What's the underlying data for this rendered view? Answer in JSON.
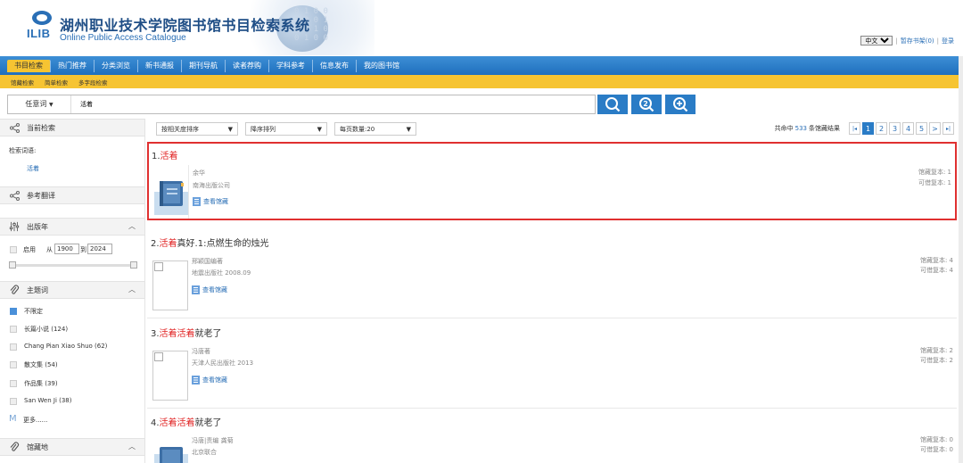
{
  "header": {
    "logo_text": "ILIB",
    "title": "湖州职业技术学院图书馆书目检索系统",
    "subtitle": "Online Public Access Catalogue",
    "binary_deco": "0 1 0 0\n1 0 0 1\n0 0 1 0\n0 1 0 0",
    "lang_value": "中文",
    "bookshelf_link": "暂存书架(0)",
    "login_link": "登录"
  },
  "nav": {
    "items": [
      "书目检索",
      "热门推荐",
      "分类浏览",
      "新书通报",
      "期刊导航",
      "读者荐购",
      "学科参考",
      "信息发布",
      "我的图书馆"
    ]
  },
  "subnav": {
    "items": [
      "馆藏检索",
      "简单检索",
      "多字段检索"
    ]
  },
  "search": {
    "field_label": "任意词",
    "query": "活着"
  },
  "sidebar": {
    "current": {
      "title": "当前检索",
      "label": "检索词语:",
      "value": "活着"
    },
    "translate": {
      "title": "参考翻译"
    },
    "year": {
      "title": "出版年",
      "enable": "启用",
      "from_label": "从",
      "from": "1900",
      "to_label": "到",
      "to": "2024"
    },
    "subject": {
      "title": "主题词",
      "items": [
        "不限定",
        "长篇小说 (124)",
        "Chang Pian Xiao Shuo (62)",
        "散文集 (54)",
        "作品集 (39)",
        "San Wen Ji (38)"
      ],
      "more": "更多......"
    },
    "location": {
      "title": "馆藏地"
    }
  },
  "toolbar": {
    "sort": "按相关度排序",
    "order": "降序排列",
    "per_page": "每页数量:20"
  },
  "pager": {
    "prefix": "共命中",
    "total": "533",
    "suffix": "条馆藏结果",
    "first": "|◂",
    "pages": [
      "1",
      "2",
      "3",
      "4",
      "5"
    ],
    "next": ">",
    "last": "▸|"
  },
  "results": [
    {
      "num": "1.",
      "title_kw": "活着",
      "title_rest": "",
      "author": "余华",
      "publisher": "南海出版公司",
      "holdings_link": "查看馆藏",
      "copies_label": "馆藏复本: 1",
      "avail_label": "可借复本: 1"
    },
    {
      "num": "2.",
      "title_kw": "活着",
      "title_rest": "真好.1:点燃生命的烛光",
      "author": "邢颖国编著",
      "publisher": "地震出版社 2008.09",
      "holdings_link": "查看馆藏",
      "copies_label": "馆藏复本: 4",
      "avail_label": "可借复本: 4"
    },
    {
      "num": "3.",
      "title_kw": "活着活着",
      "title_rest": "就老了",
      "author": "冯唐著",
      "publisher": "天津人民出版社 2013",
      "holdings_link": "查看馆藏",
      "copies_label": "馆藏复本: 2",
      "avail_label": "可借复本: 2"
    },
    {
      "num": "4.",
      "title_kw": "活着活着",
      "title_rest": "就老了",
      "author": "冯唐|责编 龚菊",
      "publisher": "北京联合",
      "holdings_link": "",
      "copies_label": "馆藏复本: 0",
      "avail_label": "可借复本: 0"
    }
  ],
  "colors": {
    "nav_blue": "#1f6fbd",
    "accent_yellow": "#f6c432",
    "highlight_red": "#e02020",
    "link_blue": "#2a6fb6"
  }
}
